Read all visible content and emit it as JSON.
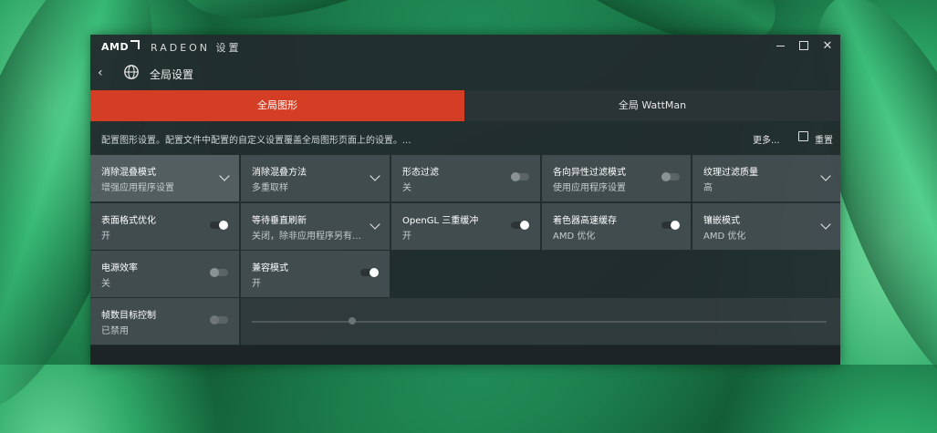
{
  "titlebar": {
    "logo": "AMD",
    "app_name": "RADEON 设置"
  },
  "nav": {
    "title": "全局设置"
  },
  "tabs": [
    {
      "label": "全局图形",
      "active": true
    },
    {
      "label": "全局 WattMan",
      "active": false
    }
  ],
  "infobar": {
    "text": "配置图形设置。配置文件中配置的自定义设置覆盖全局图形页面上的设置。...",
    "more": "更多...",
    "reset": "重置"
  },
  "cards": [
    {
      "title": "消除混叠模式",
      "value": "增强应用程序设置",
      "control": "dropdown"
    },
    {
      "title": "消除混叠方法",
      "value": "多重取样",
      "control": "dropdown"
    },
    {
      "title": "形态过滤",
      "value": "关",
      "control": "toggle-off"
    },
    {
      "title": "各向异性过滤模式",
      "value": "使用应用程序设置",
      "control": "toggle-off"
    },
    {
      "title": "纹理过滤质量",
      "value": "高",
      "control": "dropdown"
    },
    {
      "title": "表面格式优化",
      "value": "开",
      "control": "toggle-on"
    },
    {
      "title": "等待垂直刷新",
      "value": "关闭，除非应用程序另有…",
      "control": "dropdown"
    },
    {
      "title": "OpenGL 三重缓冲",
      "value": "开",
      "control": "toggle-on"
    },
    {
      "title": "着色器高速缓存",
      "value": "AMD 优化",
      "control": "toggle-on"
    },
    {
      "title": "镶嵌模式",
      "value": "AMD 优化",
      "control": "dropdown"
    },
    {
      "title": "电源效率",
      "value": "关",
      "control": "toggle-off"
    },
    {
      "title": "兼容模式",
      "value": "开",
      "control": "toggle-on"
    },
    {
      "title": "帧数目标控制",
      "value": "已禁用",
      "control": "toggle-off"
    }
  ],
  "colors": {
    "accent": "#d33e24",
    "panel": "#222c2e",
    "card": "#444f52"
  },
  "icons": [
    "back-arrow-icon",
    "globe-icon",
    "minimize-icon",
    "maximize-icon",
    "close-icon",
    "reset-icon",
    "chevron-down-icon",
    "toggle-switch"
  ]
}
